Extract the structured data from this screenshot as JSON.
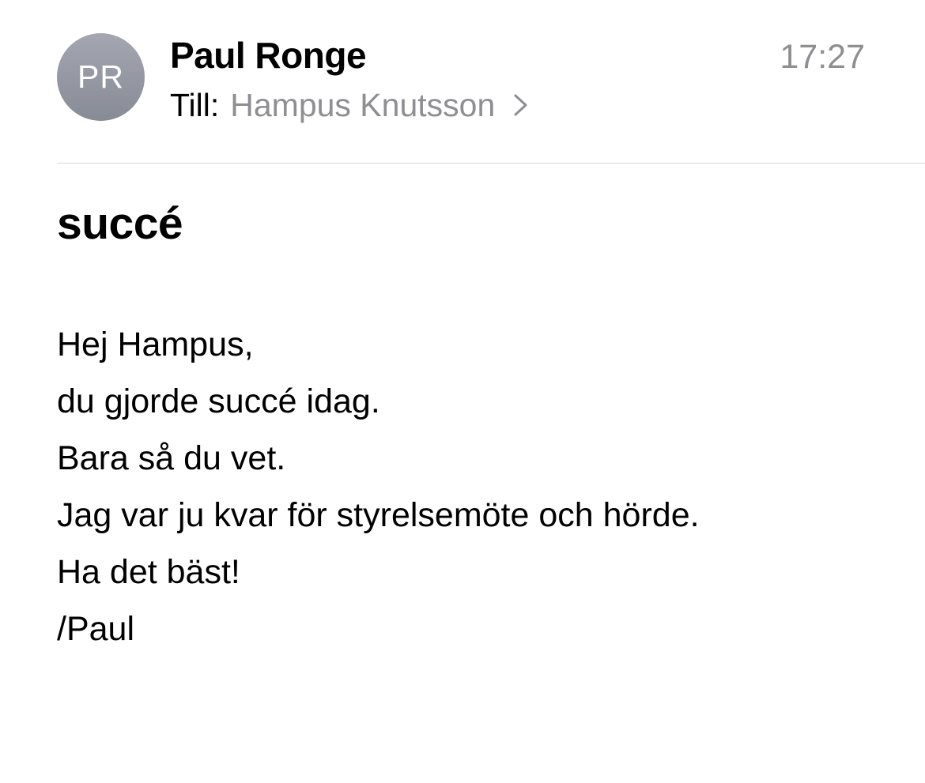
{
  "message": {
    "sender_initials": "PR",
    "sender_name": "Paul Ronge",
    "time": "17:27",
    "to_label": "Till:",
    "recipient": "Hampus Knutsson",
    "subject": "succé",
    "body_lines": [
      "Hej Hampus,",
      "du gjorde succé idag.",
      "Bara så du vet.",
      "Jag var ju kvar för styrelsemöte och hörde.",
      "Ha det bäst!",
      "/Paul"
    ]
  },
  "colors": {
    "secondary_text": "#8e8e93",
    "avatar_bg": "#979ba5",
    "divider": "#d8d8dc"
  },
  "icons": {
    "recipient_chevron": "chevron-right-icon"
  }
}
